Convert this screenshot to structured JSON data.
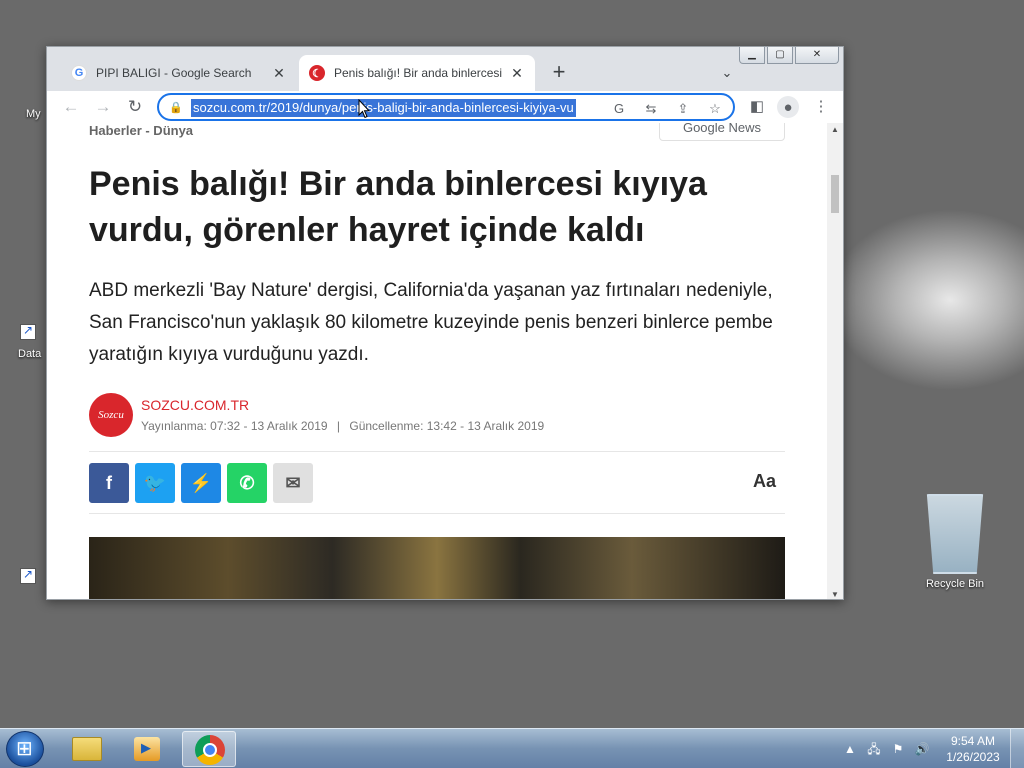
{
  "desktop": {
    "icons": [
      {
        "label": "My"
      },
      {
        "label": "Data"
      },
      {
        "label": "Recycle Bin"
      }
    ]
  },
  "browser": {
    "tabs": [
      {
        "title": "PIPI BALIGI - Google Search",
        "favicon": "google-g-icon",
        "active": false
      },
      {
        "title": "Penis balığı! Bir anda binlercesi k",
        "favicon": "sozcu-icon",
        "active": true
      }
    ],
    "new_tab_label": "+",
    "omnibox": {
      "url": "sozcu.com.tr/2019/dunya/penis-baligi-bir-anda-binlercesi-kiyiya-vu",
      "selected": true
    }
  },
  "page": {
    "breadcrumb": "Haberler - Dünya",
    "google_news": "Google News",
    "headline": "Penis balığı! Bir anda binlercesi kıyıya vurdu, görenler hayret içinde kaldı",
    "summary": "ABD merkezli 'Bay Nature' dergisi, California'da yaşanan yaz fırtınaları nedeniyle, San Francisco'nun yaklaşık 80 kilometre kuzeyinde penis benzeri binlerce pembe yaratığın kıyıya vurduğunu yazdı.",
    "author": {
      "logo_text": "Sozcu",
      "name": "SOZCU.COM.TR",
      "published": "Yayınlanma: 07:32 - 13 Aralık 2019",
      "separator": "|",
      "updated": "Güncellenme: 13:42 - 13 Aralık 2019"
    },
    "share": {
      "facebook": "f",
      "twitter": "🐦",
      "messenger": "⚡",
      "whatsapp": "✆",
      "email": "✉"
    },
    "text_size_label": "Aa"
  },
  "taskbar": {
    "time": "9:54 AM",
    "date": "1/26/2023"
  },
  "colors": {
    "accent": "#1a73e8",
    "sozcu_red": "#d9262c",
    "facebook": "#3b5998",
    "twitter": "#1da1f2",
    "messenger": "#1e88e5",
    "whatsapp": "#25d366"
  }
}
